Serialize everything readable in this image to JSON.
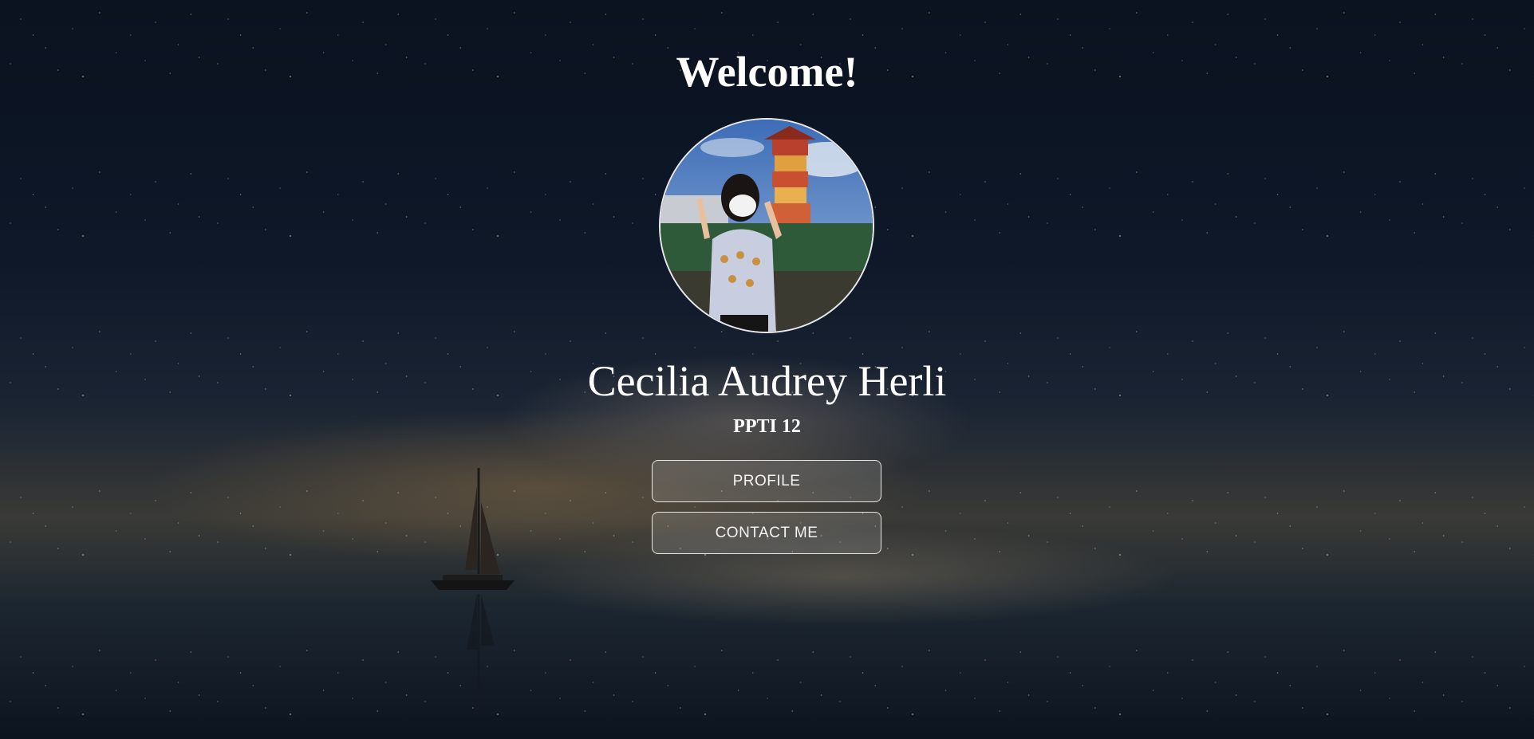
{
  "page": {
    "welcome_title": "Welcome!",
    "name": "Cecilia Audrey Herli",
    "subtitle": "PPTI 12"
  },
  "avatar": {
    "alt": "Cecilia Audrey Herli",
    "description_icon": "profile-photo"
  },
  "buttons": {
    "profile_label": "PROFILE",
    "contact_label": "CONTACT ME"
  },
  "colors": {
    "text": "#ffffff",
    "button_border": "#e6e6e6",
    "sky_top": "#0b1220",
    "glow": "#8c6e46"
  }
}
